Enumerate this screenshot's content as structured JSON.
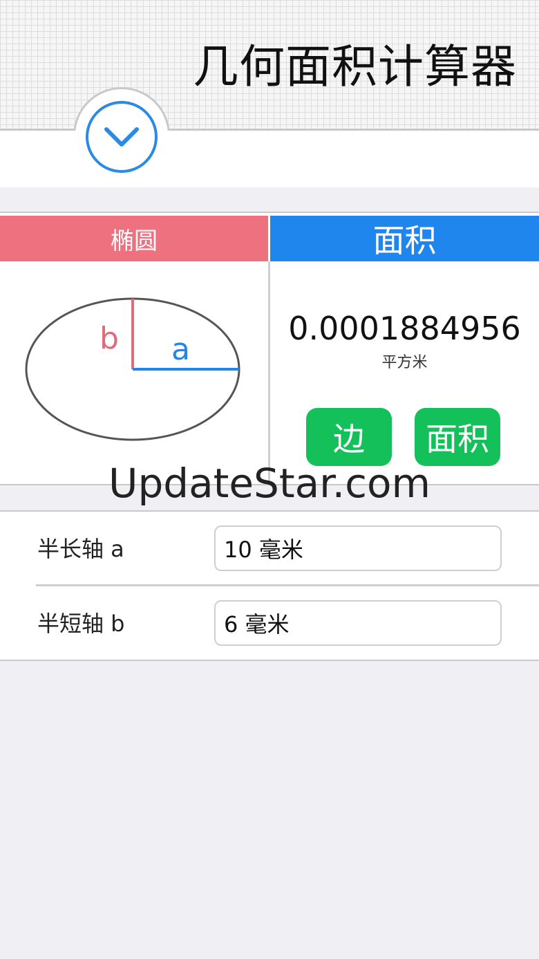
{
  "header": {
    "title": "几何面积计算器"
  },
  "shape": {
    "name": "椭圆",
    "diagram": {
      "label_a": "a",
      "label_b": "b",
      "color_a": "#1f86ee",
      "color_b": "#e06b7a",
      "ellipse_stroke": "#555555"
    }
  },
  "result": {
    "header": "面积",
    "value": "0.0001884956",
    "unit": "平方米"
  },
  "buttons": {
    "side": "边",
    "area": "面积"
  },
  "watermark": "UpdateStar.com",
  "fields": [
    {
      "label": "半长轴 a",
      "value": "10 毫米"
    },
    {
      "label": "半短轴 b",
      "value": "6 毫米"
    }
  ],
  "colors": {
    "shape_header": "#ed717f",
    "result_header": "#1f86ee",
    "button_green": "#14c05a",
    "chevron_blue": "#2a8ae6"
  },
  "icons": {
    "toggle": "chevron-down-icon"
  }
}
